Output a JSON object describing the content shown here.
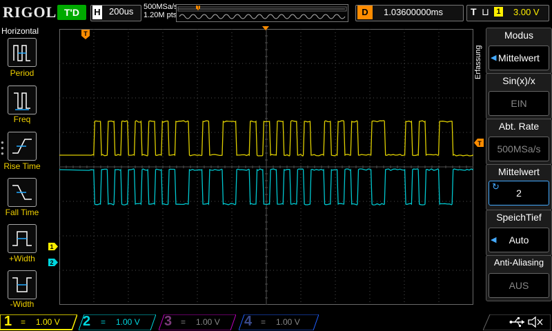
{
  "header": {
    "logo": "RIGOL",
    "run_state": "T'D",
    "horizontal_letter": "H",
    "timebase": "200us",
    "sample_rate": "500MSa/s",
    "memory_points": "1.20M pts",
    "delay_letter": "D",
    "delay_value": "1.03600000ms",
    "trigger_letter": "T",
    "trigger_edge": "⊔",
    "trigger_channel": "1",
    "trigger_level": "3.00 V"
  },
  "left_menu": {
    "title": "Horizontal",
    "items": [
      {
        "label": "Period"
      },
      {
        "label": "Freq"
      },
      {
        "label": "Rise Time"
      },
      {
        "label": "Fall Time"
      },
      {
        "label": "+Width"
      },
      {
        "label": "-Width"
      }
    ]
  },
  "right_menu": {
    "section_label": "Erfassung",
    "items": [
      {
        "title": "Modus",
        "value": "Mittelwert"
      },
      {
        "title": "Sin(x)/x",
        "value": "EIN"
      },
      {
        "title": "Abt. Rate",
        "value": "500MSa/s"
      },
      {
        "title": "Mittelwert",
        "value": "2"
      },
      {
        "title": "SpeichTief",
        "value": "Auto"
      },
      {
        "title": "Anti-Aliasing",
        "value": "AUS"
      }
    ]
  },
  "channels": [
    {
      "num": "1",
      "coupling": "=",
      "scale": "1.00 V",
      "color": "#ffef00",
      "active": true
    },
    {
      "num": "2",
      "coupling": "=",
      "scale": "1.00 V",
      "color": "#00d8e0",
      "active": true
    },
    {
      "num": "3",
      "coupling": "=",
      "scale": "1.00 V",
      "color": "#c000c0",
      "active": false
    },
    {
      "num": "4",
      "coupling": "=",
      "scale": "1.00 V",
      "color": "#2060ff",
      "active": false
    }
  ],
  "markers": {
    "trigger_position": "T",
    "trigger_level": "T",
    "ch1_offset": "1",
    "ch2_offset": "2"
  },
  "colors": {
    "ch1": "#e0d000",
    "ch2": "#00c8d0",
    "trigger": "#ff8c00",
    "grid": "#505050"
  },
  "waveform": {
    "ch1_bits": "0101010101010110010011001010101010010101001100010100110",
    "ch2_bits": "0101010101010110010011001010101010010101001100010100110"
  }
}
